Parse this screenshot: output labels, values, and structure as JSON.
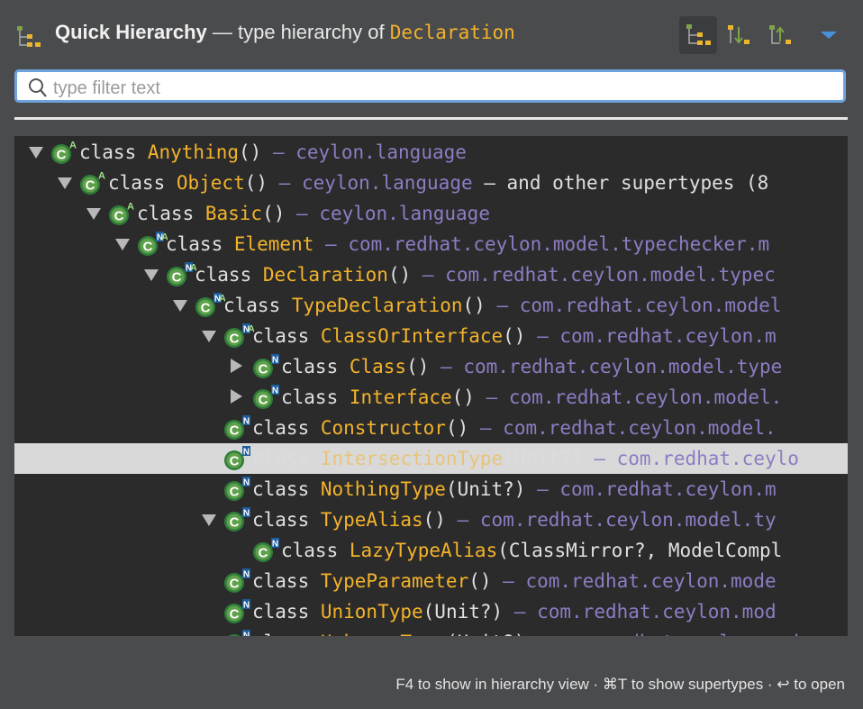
{
  "header": {
    "title_bold": "Quick Hierarchy",
    "title_rest": " — type hierarchy of ",
    "title_type": "Declaration",
    "toolbar": [
      "type-hierarchy-icon",
      "supertypes-icon",
      "subtypes-icon",
      "view-menu-icon"
    ]
  },
  "search": {
    "placeholder": "type filter text",
    "value": ""
  },
  "tree": {
    "rows": [
      {
        "toggle": "open",
        "icon": "class-abstract-icon",
        "keyword": "class ",
        "name": "Anything",
        "params": "()",
        "dash": " — ",
        "package": "ceylon.language",
        "extra": ""
      },
      {
        "toggle": "open",
        "icon": "class-abstract-icon",
        "keyword": "class ",
        "name": "Object",
        "params": "()",
        "dash": " — ",
        "package": "ceylon.language",
        "extra": " — and other supertypes (8"
      },
      {
        "toggle": "open",
        "icon": "class-abstract-icon",
        "keyword": "class ",
        "name": "Basic",
        "params": "()",
        "dash": " — ",
        "package": "ceylon.language",
        "extra": ""
      },
      {
        "toggle": "open",
        "icon": "class-native-abstract-icon",
        "keyword": "class ",
        "name": "Element",
        "params": "",
        "dash": " — ",
        "package": "com.redhat.ceylon.model.typechecker.m",
        "extra": ""
      },
      {
        "toggle": "open",
        "icon": "class-native-abstract-icon",
        "keyword": "class ",
        "name": "Declaration",
        "params": "()",
        "dash": " — ",
        "package": "com.redhat.ceylon.model.typec",
        "extra": ""
      },
      {
        "toggle": "open",
        "icon": "class-native-abstract-icon",
        "keyword": "class ",
        "name": "TypeDeclaration",
        "params": "()",
        "dash": " — ",
        "package": "com.redhat.ceylon.model",
        "extra": ""
      },
      {
        "toggle": "open",
        "icon": "class-native-abstract-icon",
        "keyword": "class ",
        "name": "ClassOrInterface",
        "params": "()",
        "dash": " — ",
        "package": "com.redhat.ceylon.m",
        "extra": ""
      },
      {
        "toggle": "closed",
        "icon": "class-native-icon",
        "keyword": "class ",
        "name": "Class",
        "params": "()",
        "dash": " — ",
        "package": "com.redhat.ceylon.model.type",
        "extra": ""
      },
      {
        "toggle": "closed",
        "icon": "class-native-icon",
        "keyword": "class ",
        "name": "Interface",
        "params": "()",
        "dash": " — ",
        "package": "com.redhat.ceylon.model.",
        "extra": ""
      },
      {
        "toggle": "none",
        "icon": "class-native-icon",
        "keyword": "class ",
        "name": "Constructor",
        "params": "()",
        "dash": " — ",
        "package": "com.redhat.ceylon.model.",
        "extra": ""
      },
      {
        "toggle": "none",
        "icon": "class-native-icon",
        "keyword": "class ",
        "name": "IntersectionType",
        "params": "(Unit?)",
        "dash": " — ",
        "package": "com.redhat.ceylo",
        "extra": ""
      },
      {
        "toggle": "none",
        "icon": "class-native-icon",
        "keyword": "class ",
        "name": "NothingType",
        "params": "(Unit?)",
        "dash": " — ",
        "package": "com.redhat.ceylon.m",
        "extra": ""
      },
      {
        "toggle": "open",
        "icon": "class-native-icon",
        "keyword": "class ",
        "name": "TypeAlias",
        "params": "()",
        "dash": " — ",
        "package": "com.redhat.ceylon.model.ty",
        "extra": ""
      },
      {
        "toggle": "none",
        "icon": "class-native-icon",
        "keyword": "class ",
        "name": "LazyTypeAlias",
        "params": "(ClassMirror?, ModelCompl",
        "dash": "",
        "package": "",
        "extra": ""
      },
      {
        "toggle": "none",
        "icon": "class-native-icon",
        "keyword": "class ",
        "name": "TypeParameter",
        "params": "()",
        "dash": " — ",
        "package": "com.redhat.ceylon.mode",
        "extra": ""
      },
      {
        "toggle": "none",
        "icon": "class-native-icon",
        "keyword": "class ",
        "name": "UnionType",
        "params": "(Unit?)",
        "dash": " — ",
        "package": "com.redhat.ceylon.mod",
        "extra": ""
      },
      {
        "toggle": "none",
        "icon": "class-native-icon",
        "keyword": "class ",
        "name": "UnknownType",
        "params": "(Unit?)",
        "dash": " — ",
        "package": "com.redhat.ceylon.mod",
        "extra": ""
      }
    ],
    "selected_index": 10
  },
  "footer": {
    "hint": "F4 to show in hierarchy view · ⌘T to show supertypes · ↩ to open"
  },
  "colors": {
    "type_name": "#f3b32b",
    "package": "#8e7cc3",
    "tree_bg": "#2b2b2b",
    "search_border": "#6fa3de"
  }
}
